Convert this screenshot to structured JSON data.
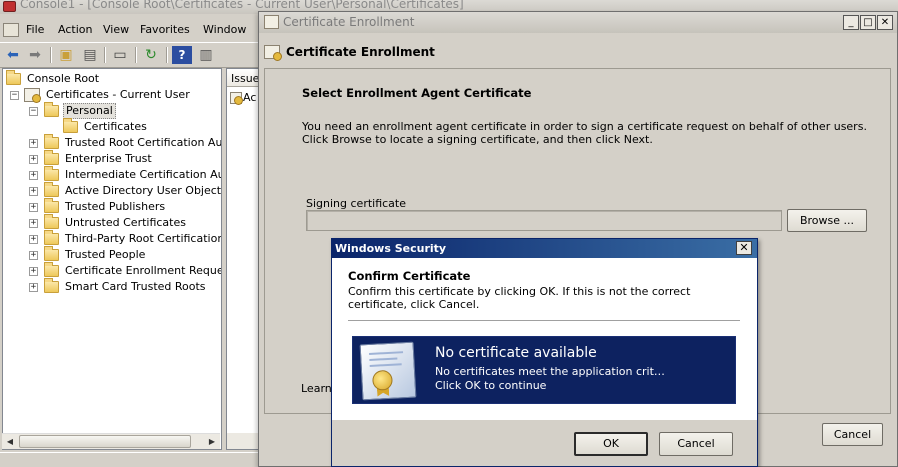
{
  "console": {
    "title": "Console1 - [Console Root\\Certificates - Current User\\Personal\\Certificates]",
    "menu": [
      "File",
      "Action",
      "View",
      "Favorites",
      "Window"
    ],
    "tree": {
      "root": "Console Root",
      "store": "Certificates - Current User",
      "personal": "Personal",
      "certificates": "Certificates",
      "items": [
        "Trusted Root Certification Autho",
        "Enterprise Trust",
        "Intermediate Certification Autho",
        "Active Directory User Object",
        "Trusted Publishers",
        "Untrusted Certificates",
        "Third-Party Root Certification Au",
        "Trusted People",
        "Certificate Enrollment Requests",
        "Smart Card Trusted Roots"
      ]
    },
    "list": {
      "column_header": "Issue",
      "first_row": "Ac"
    }
  },
  "enrollment": {
    "title": "Certificate Enrollment",
    "header": "Certificate Enrollment",
    "heading": "Select Enrollment Agent Certificate",
    "description": "You need an enrollment agent certificate in order to sign a certificate request on behalf of other users. Click Browse to locate a signing certificate, and then click Next.",
    "signing_label": "Signing certificate",
    "signing_value": "",
    "browse_label": "Browse ...",
    "learn_label": "Learn",
    "cancel_label": "Cancel"
  },
  "security": {
    "title": "Windows Security",
    "heading": "Confirm Certificate",
    "description": "Confirm this certificate by clicking OK. If this is not the correct certificate, click Cancel.",
    "cert_title": "No certificate available",
    "cert_line1": "No certificates meet the application crit…",
    "cert_line2": "Click OK to continue",
    "ok_label": "OK",
    "cancel_label": "Cancel",
    "tile_color": "#0d2260"
  }
}
